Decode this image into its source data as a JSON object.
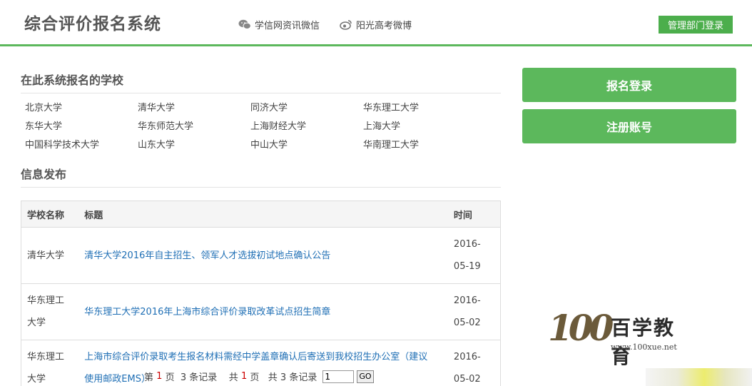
{
  "header": {
    "title": "综合评价报名系统",
    "wechat_label": "学信网资讯微信",
    "weibo_label": "阳光高考微博",
    "admin_login": "管理部门登录"
  },
  "schools": {
    "title": "在此系统报名的学校",
    "items": [
      "北京大学",
      "清华大学",
      "同济大学",
      "华东理工大学",
      "东华大学",
      "华东师范大学",
      "上海财经大学",
      "上海大学",
      "中国科学技术大学",
      "山东大学",
      "中山大学",
      "华南理工大学"
    ]
  },
  "news": {
    "title": "信息发布",
    "headers": {
      "school": "学校名称",
      "title": "标题",
      "time": "时间"
    },
    "rows": [
      {
        "school": "清华大学",
        "title": "清华大学2016年自主招生、领军人才选拔初试地点确认公告",
        "time": "2016-05-19"
      },
      {
        "school": "华东理工大学",
        "title": "华东理工大学2016年上海市综合评价录取改革试点招生简章",
        "time": "2016-05-02"
      },
      {
        "school": "华东理工大学",
        "title": "上海市综合评价录取考生报名材料需经中学盖章确认后寄送到我校招生办公室（建议使用邮政EMS）",
        "time": "2016-05-02"
      }
    ]
  },
  "pager": {
    "prefix": "第",
    "current_page": "1",
    "page_suffix": "页",
    "records": "3 条记录",
    "total_prefix": "共",
    "total_pages": "1",
    "total_suffix": "页",
    "total_records": "共 3 条记录",
    "input_value": "1",
    "go_label": "GO"
  },
  "actions": {
    "login": "报名登录",
    "register": "注册账号"
  },
  "watermark": {
    "number": "100",
    "brand": "百学教育",
    "url": "www.100xue.net"
  },
  "colors": {
    "accent_green": "#5cb85c",
    "link_blue": "#1f6fb5",
    "page_red": "#cc0000"
  }
}
